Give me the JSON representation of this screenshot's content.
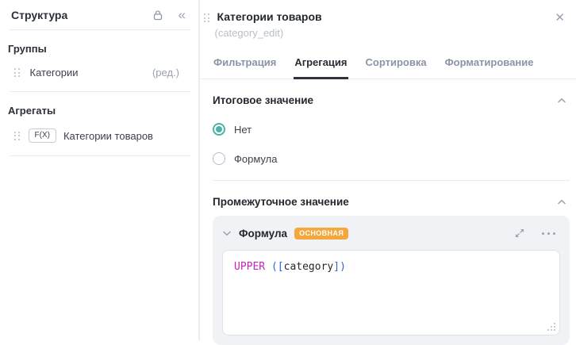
{
  "left_panel": {
    "title": "Структура",
    "groups": {
      "header": "Группы",
      "items": [
        {
          "label": "Категории",
          "action": "(ред.)"
        }
      ]
    },
    "aggregates": {
      "header": "Агрегаты",
      "items": [
        {
          "badge": "F(X)",
          "label": "Категории товаров"
        }
      ]
    }
  },
  "right_panel": {
    "title": "Категории товаров",
    "subtitle": "(category_edit)",
    "tabs": [
      {
        "label": "Фильтрация",
        "active": false
      },
      {
        "label": "Агрегация",
        "active": true
      },
      {
        "label": "Сортировка",
        "active": false
      },
      {
        "label": "Форматирование",
        "active": false
      }
    ],
    "total_section": {
      "title": "Итоговое значение",
      "options": [
        {
          "label": "Нет",
          "selected": true
        },
        {
          "label": "Формула",
          "selected": false
        }
      ]
    },
    "intermediate_section": {
      "title": "Промежуточное значение",
      "card": {
        "title": "Формула",
        "badge": "ОСНОВНАЯ",
        "code_tokens": [
          {
            "text": "UPPER",
            "type": "keyword"
          },
          {
            "text": " (",
            "type": "bracket"
          },
          {
            "text": "[",
            "type": "bracket"
          },
          {
            "text": "category",
            "type": "field"
          },
          {
            "text": "]",
            "type": "bracket"
          },
          {
            "text": ")",
            "type": "bracket"
          }
        ]
      }
    }
  },
  "icons": {
    "collapse": "«",
    "close": "✕"
  },
  "colors": {
    "accent_teal": "#4db2a8",
    "badge_orange": "#f3a73c",
    "code_keyword": "#c127b8",
    "code_bracket": "#2e62d9",
    "tab_underline": "#30343c",
    "inactive_tab": "#8a94a6"
  }
}
